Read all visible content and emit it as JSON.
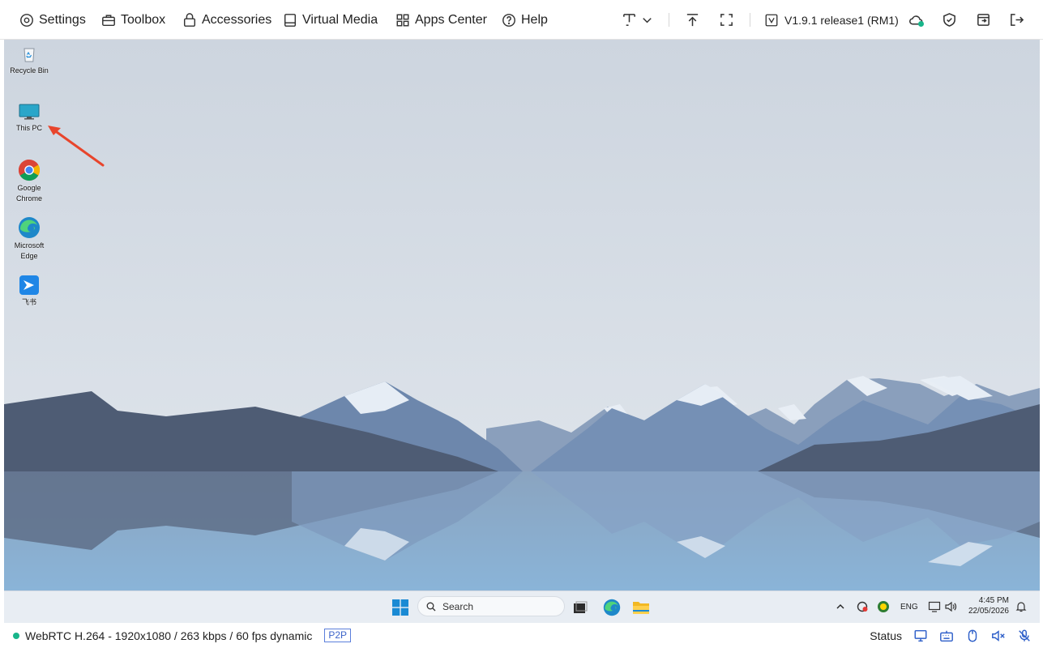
{
  "toolbar": {
    "settings": "Settings",
    "toolbox": "Toolbox",
    "accessories": "Accessories",
    "virtual_media": "Virtual Media",
    "apps_center": "Apps Center",
    "help": "Help",
    "version": "V1.9.1 release1 (RM1)"
  },
  "desktop": {
    "icons": [
      {
        "label": "Recycle Bin",
        "icon": "recycle-bin-icon"
      },
      {
        "label": "This PC",
        "icon": "monitor-icon"
      },
      {
        "label": "Google\nChrome",
        "icon": "chrome-icon"
      },
      {
        "label": "Microsoft\nEdge",
        "icon": "edge-icon"
      },
      {
        "label": "飞书",
        "icon": "feishu-icon"
      }
    ]
  },
  "taskbar": {
    "search_placeholder": "Search",
    "language": "ENG",
    "time": "4:45 PM",
    "date": "22/05/2026"
  },
  "status": {
    "stream_info": "WebRTC H.264 - 1920x1080 /  263 kbps / 60 fps dynamic",
    "mode": "P2P",
    "status_label": "Status"
  },
  "colors": {
    "accent": "#2e5fc9",
    "connected": "#18b58a",
    "arrow": "#e8452c"
  }
}
